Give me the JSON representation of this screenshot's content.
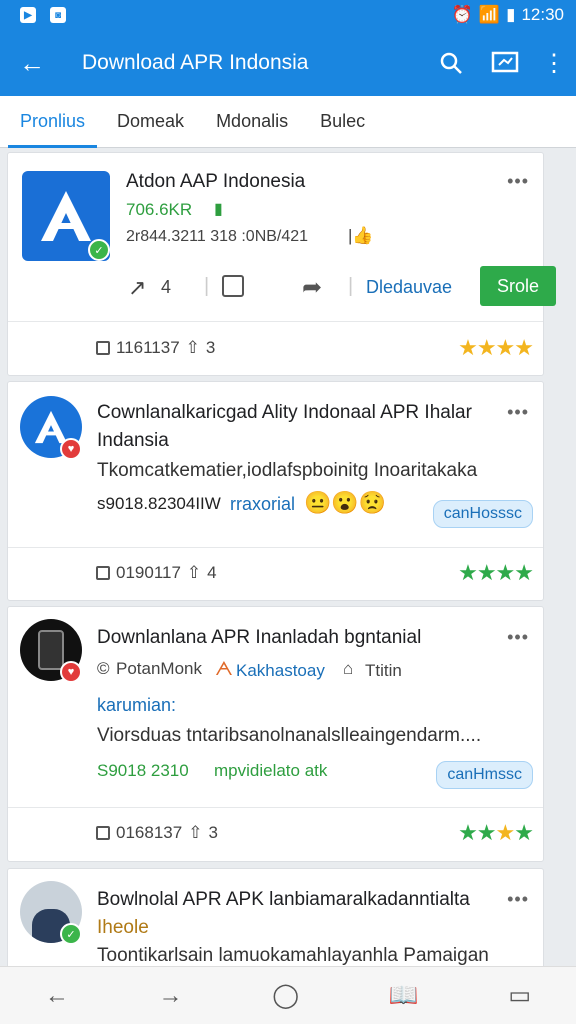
{
  "status": {
    "time": "12:30"
  },
  "appbar": {
    "title": "Download APR Indonsia"
  },
  "tabs": [
    "Pronlius",
    "Domeak",
    "Mdonalis",
    "Bulec"
  ],
  "card1": {
    "title": "Atdon AAP Indonesia",
    "size": "706.6KR",
    "meta": "2r844.3211 318 :0NB/421",
    "count": "4",
    "link": "Dledauvae",
    "button": "Srole",
    "foot_value": "1161137",
    "foot_count": "3"
  },
  "card2": {
    "title1": "Cownlanalkaricgad Ality  Indonaal APR Ihalar",
    "title2": "Indansia",
    "desc": "Tkomcatkematier,iodlafspboinitg Inoaritakaka",
    "meta": "s9018.82304IIW",
    "link": "rraxorial",
    "pill": "canHosssc",
    "foot_value": "0190117",
    "foot_count": "4"
  },
  "card3": {
    "title": "Downlanlana APR Inanladah bgntanial",
    "author": "PotanMonk",
    "tag": "Kakhastoay",
    "extra": "Ttitin",
    "subtitle": "karumian:",
    "desc": "Viorsduas tntaribsanolnanalslleaingendarm....",
    "meta": "S9018  2310",
    "meta2": "mpvidielato atk",
    "pill": "canHmssc",
    "foot_value": "0168137",
    "foot_count": "3"
  },
  "card4": {
    "title": "Bowlnolal APR APK lanbiamaralkadanntialta",
    "subtitle": "Iheole",
    "desc": "Toontikarlsain lamuokamahlayanhla Pamaigan"
  }
}
